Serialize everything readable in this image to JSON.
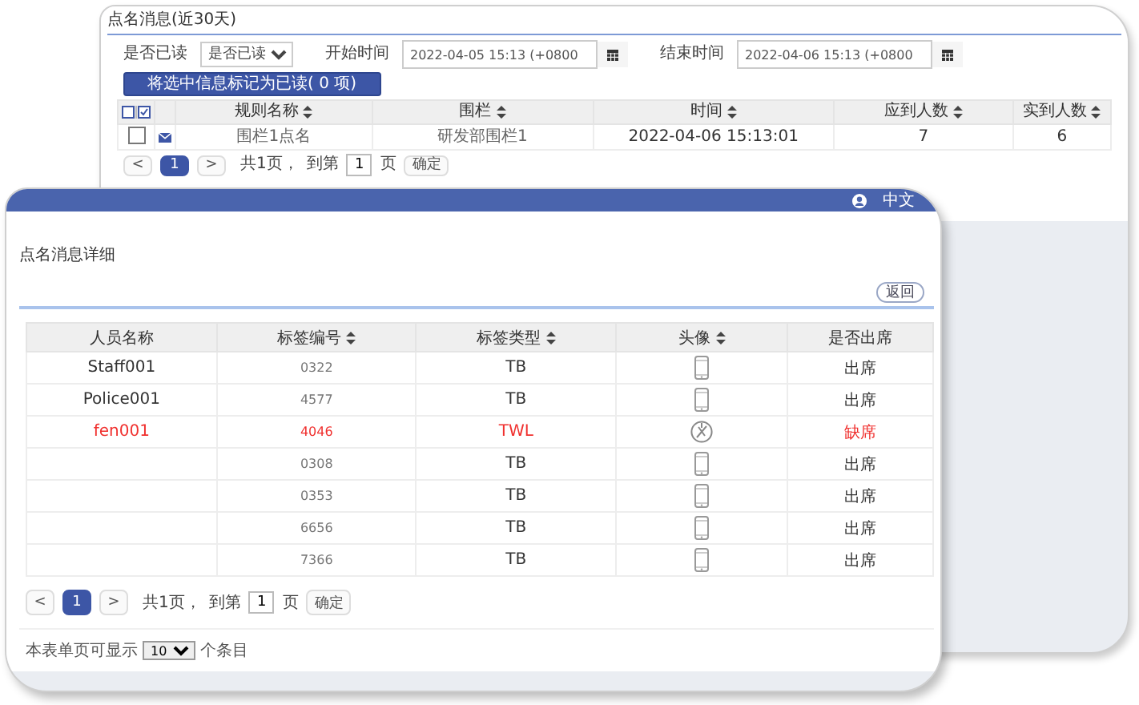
{
  "back_window": {
    "title": "点名消息(近30天)",
    "filters": {
      "read_label": "是否已读",
      "read_select": "是否已读",
      "start_label": "开始时间",
      "start_value": "2022-04-05 15:13 (+0800",
      "end_label": "结束时间",
      "end_value": "2022-04-06 15:13 (+0800"
    },
    "mark_read_button": "将选中信息标记为已读( 0 项)",
    "table": {
      "columns": [
        {
          "label": "规则名称",
          "sortable": true
        },
        {
          "label": "围栏",
          "sortable": true
        },
        {
          "label": "时间",
          "sortable": true
        },
        {
          "label": "应到人数",
          "sortable": true
        },
        {
          "label": "实到人数",
          "sortable": true
        }
      ],
      "rows": [
        {
          "checked": false,
          "cells": [
            "围栏1点名",
            "研发部围栏1",
            "2022-04-06 15:13:01",
            "7",
            "6"
          ]
        }
      ]
    },
    "pagination": {
      "prev": "<",
      "current": "1",
      "next": ">",
      "total": "共1页，",
      "goto_label": "到第",
      "goto_value": "1",
      "page_label": "页",
      "confirm": "确定"
    }
  },
  "detail_window": {
    "header": {
      "language": "中文"
    },
    "title": "点名消息详细",
    "back_button": "返回",
    "table": {
      "columns": [
        {
          "label": "人员名称",
          "sortable": false
        },
        {
          "label": "标签编号",
          "sortable": true
        },
        {
          "label": "标签类型",
          "sortable": true
        },
        {
          "label": "头像",
          "sortable": true
        },
        {
          "label": "是否出席",
          "sortable": false
        }
      ],
      "rows": [
        {
          "name": "Staff001",
          "tag_no": "0322",
          "tag_type": "TB",
          "kind": "phone",
          "attendance": "出席",
          "absent": false
        },
        {
          "name": "Police001",
          "tag_no": "4577",
          "tag_type": "TB",
          "kind": "phone",
          "attendance": "出席",
          "absent": false
        },
        {
          "name": "fen001",
          "tag_no": "4046",
          "tag_type": "TWL",
          "kind": "alarm",
          "attendance": "缺席",
          "absent": true
        },
        {
          "tag_no": "0308",
          "tag_type": "TB",
          "kind": "phone",
          "attendance": "出席",
          "absent": false
        },
        {
          "tag_no": "0353",
          "tag_type": "TB",
          "kind": "phone",
          "attendance": "出席",
          "absent": false
        },
        {
          "tag_no": "6656",
          "tag_type": "TB",
          "kind": "phone",
          "attendance": "出席",
          "absent": false
        },
        {
          "tag_no": "7366",
          "tag_type": "TB",
          "kind": "phone",
          "attendance": "出席",
          "absent": false
        }
      ]
    },
    "pagination": {
      "prev": "<",
      "current": "1",
      "next": ">",
      "total": "共1页，",
      "goto_label": "到第",
      "goto_value": "1",
      "page_label": "页",
      "confirm": "确定"
    },
    "page_size": {
      "label": "本表单页可显示",
      "value": "10",
      "suffix": "个条目"
    }
  }
}
